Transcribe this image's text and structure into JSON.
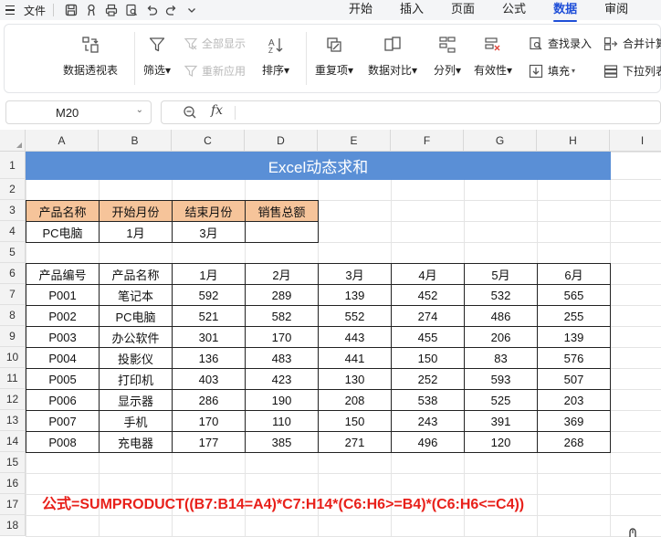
{
  "menubar": {
    "file_label": "文件",
    "tabs": [
      "开始",
      "插入",
      "页面",
      "公式",
      "数据",
      "审阅"
    ],
    "active_tab": "数据"
  },
  "ribbon": {
    "pivot": "数据透视表",
    "filter": "筛选",
    "show_all": "全部显示",
    "reapply": "重新应用",
    "sort": "排序",
    "duplicates": "重复项",
    "compare": "数据对比",
    "split": "分列",
    "validity": "有效性",
    "lookup_entry": "查找录入",
    "fill": "填充",
    "merge_calc": "合并计算",
    "dropdown_list": "下拉列表"
  },
  "formula_bar": {
    "name_box": "M20",
    "fx": "fx",
    "content": ""
  },
  "columns": [
    "A",
    "B",
    "C",
    "D",
    "E",
    "F",
    "G",
    "H",
    "I"
  ],
  "rows": [
    "1",
    "2",
    "3",
    "4",
    "5",
    "6",
    "7",
    "8",
    "9",
    "10",
    "11",
    "12",
    "13",
    "14",
    "15",
    "16",
    "17",
    "18"
  ],
  "sheet": {
    "title": "Excel动态求和",
    "criteria_headers": [
      "产品名称",
      "开始月份",
      "结束月份",
      "销售总额"
    ],
    "criteria_values": [
      "PC电脑",
      "1月",
      "3月",
      ""
    ],
    "table_headers": [
      "产品编号",
      "产品名称",
      "1月",
      "2月",
      "3月",
      "4月",
      "5月",
      "6月"
    ],
    "table_rows": [
      [
        "P001",
        "笔记本",
        "592",
        "289",
        "139",
        "452",
        "532",
        "565"
      ],
      [
        "P002",
        "PC电脑",
        "521",
        "582",
        "552",
        "274",
        "486",
        "255"
      ],
      [
        "P003",
        "办公软件",
        "301",
        "170",
        "443",
        "455",
        "206",
        "139"
      ],
      [
        "P004",
        "投影仪",
        "136",
        "483",
        "441",
        "150",
        "83",
        "576"
      ],
      [
        "P005",
        "打印机",
        "403",
        "423",
        "130",
        "252",
        "593",
        "507"
      ],
      [
        "P006",
        "显示器",
        "286",
        "190",
        "208",
        "538",
        "525",
        "203"
      ],
      [
        "P007",
        "手机",
        "170",
        "110",
        "150",
        "243",
        "391",
        "369"
      ],
      [
        "P008",
        "充电器",
        "177",
        "385",
        "271",
        "496",
        "120",
        "268"
      ]
    ],
    "formula_note": "公式=SUMPRODUCT((B7:B14=A4)*C7:H14*(C6:H6>=B4)*(C6:H6<=C4))"
  },
  "colors": {
    "title_fill": "#5a8fd6",
    "header_fill": "#f6c49a",
    "note_text": "#e8201a",
    "active_tab": "#1f4fd8"
  }
}
